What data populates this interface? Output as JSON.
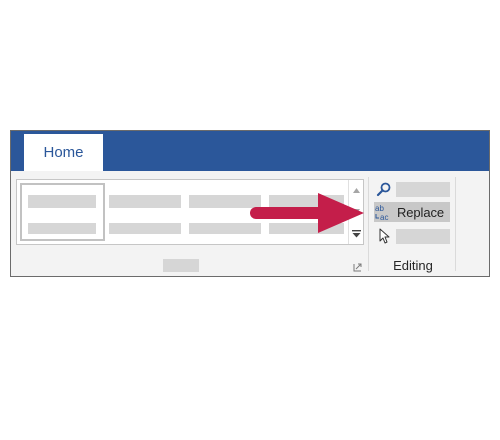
{
  "tabs": {
    "home_label": "Home"
  },
  "editing_group": {
    "replace_label": "Replace",
    "group_label": "Editing"
  },
  "icons": {
    "find": "magnifier-icon",
    "replace": "replace-abc-icon",
    "select": "cursor-arrow-icon",
    "launcher": "dialog-launcher-icon"
  },
  "colors": {
    "titlebar": "#2b579a",
    "ribbon": "#f3f3f3",
    "highlight": "#c8c8c8",
    "annotation_arrow": "#c41e4a"
  }
}
